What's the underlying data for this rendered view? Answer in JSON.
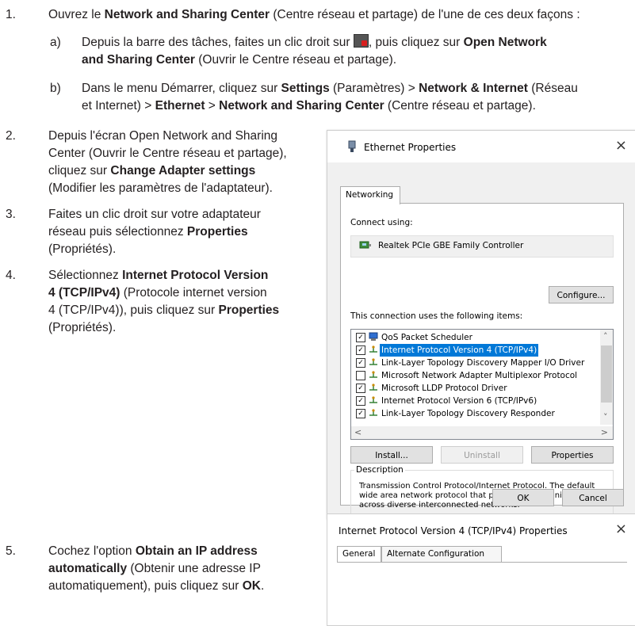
{
  "steps": [
    {
      "num": "1.",
      "parts": [
        "Ouvrez le ",
        "Network and Sharing Center",
        " (Centre réseau et partage) de l'une de ces deux façons :"
      ],
      "sub": [
        {
          "label": "a)",
          "line1a": "Depuis la barre des tâches, faites un clic droit sur ",
          "line1b": ", puis cliquez sur ",
          "line1c": "Open Network",
          "line2a": "and Sharing Center",
          "line2b": " (Ouvrir le Centre réseau et partage)."
        },
        {
          "label": "b)",
          "line1a": "Dans le menu Démarrer, cliquez sur ",
          "line1b": "Settings",
          "line1c": " (Paramètres) > ",
          "line1d": "Network & Internet",
          "line1e": " (Réseau",
          "line2a": "et Internet) > ",
          "line2b": "Ethernet",
          "line2c": " > ",
          "line2d": "Network and Sharing Center",
          "line2e": " (Centre réseau et partage)."
        }
      ]
    },
    {
      "num": "2.",
      "l1": "Depuis l'écran Open Network and Sharing",
      "l2": "Center (Ouvrir le Centre réseau et partage),",
      "l3a": "cliquez sur ",
      "l3b": "Change Adapter settings",
      "l4": "(Modifier les paramètres de l'adaptateur)."
    },
    {
      "num": "3.",
      "l1": "Faites un clic droit sur votre adaptateur",
      "l2a": "réseau puis sélectionnez ",
      "l2b": "Properties",
      "l3": "(Propriétés)."
    },
    {
      "num": "4.",
      "l1a": "Sélectionnez ",
      "l1b": "Internet Protocol Version",
      "l2a": "4 (TCP/IPv4)",
      "l2b": " (Protocole internet version",
      "l3a": "4 (TCP/IPv4)), puis cliquez sur ",
      "l3b": "Properties",
      "l4": "(Propriétés)."
    },
    {
      "num": "5.",
      "l1a": "Cochez l'option ",
      "l1b": "Obtain an IP address",
      "l2a": "automatically",
      "l2b": " (Obtenir une adresse IP",
      "l3a": "automatiquement), puis cliquez sur ",
      "l3b": "OK",
      "l3c": "."
    }
  ],
  "dialog": {
    "title": "Ethernet Properties",
    "close": "×",
    "tab": "Networking",
    "connect_using": "Connect using:",
    "adapter": "Realtek PCIe GBE Family Controller",
    "configure": "Configure...",
    "items_label": "This connection uses the following items:",
    "items": [
      {
        "checked": true,
        "label": "QoS Packet Scheduler",
        "icon": "qos-icon",
        "selected": false
      },
      {
        "checked": true,
        "label": "Internet Protocol Version 4 (TCP/IPv4)",
        "icon": "network-protocol-icon",
        "selected": true
      },
      {
        "checked": true,
        "label": "Link-Layer Topology Discovery Mapper I/O Driver",
        "icon": "network-protocol-icon",
        "selected": false
      },
      {
        "checked": false,
        "label": "Microsoft Network Adapter Multiplexor Protocol",
        "icon": "network-protocol-icon",
        "selected": false
      },
      {
        "checked": true,
        "label": "Microsoft LLDP Protocol Driver",
        "icon": "network-protocol-icon",
        "selected": false
      },
      {
        "checked": true,
        "label": "Internet Protocol Version 6 (TCP/IPv6)",
        "icon": "network-protocol-icon",
        "selected": false
      },
      {
        "checked": true,
        "label": "Link-Layer Topology Discovery Responder",
        "icon": "network-protocol-icon",
        "selected": false
      }
    ],
    "install": "Install...",
    "uninstall": "Uninstall",
    "properties": "Properties",
    "description_label": "Description",
    "description": "Transmission Control Protocol/Internet Protocol. The default wide area network protocol that provides communication across diverse interconnected networks.",
    "ok": "OK",
    "cancel": "Cancel"
  },
  "dialog2": {
    "title": "Internet Protocol Version 4 (TCP/IPv4) Properties",
    "close": "×",
    "tab_general": "General",
    "tab_alt": "Alternate Configuration"
  }
}
